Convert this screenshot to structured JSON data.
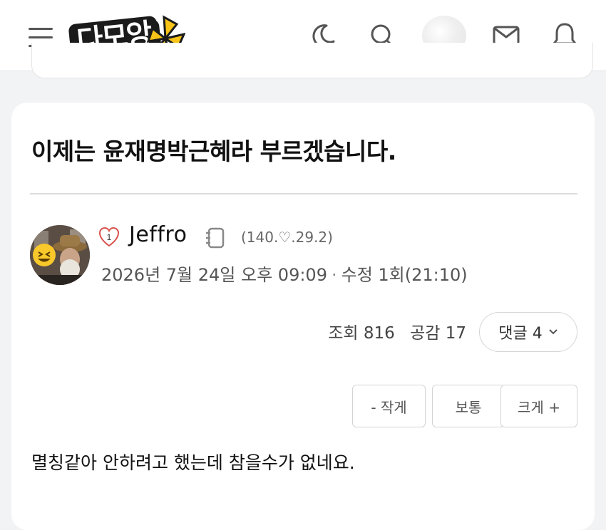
{
  "header": {
    "logo_text": "다모앙",
    "icons": [
      "menu-icon",
      "moon-icon",
      "search-icon",
      "profile-avatar",
      "mail-icon",
      "bell-icon"
    ]
  },
  "post": {
    "title": "이제는 윤재명박근혜라 부르겠습니다.",
    "author": {
      "level": "1",
      "nickname": "Jeffro",
      "ip": "(140.♡.29.2)"
    },
    "date": "2026년 7월 24일 오후 09:09",
    "edit_info": "수정 1회(21:10)",
    "stats": {
      "views_label": "조회 816",
      "likes_label": "공감 17"
    },
    "comment_button": "댓글 4",
    "font_size_buttons": {
      "small": "- 작게",
      "normal": "보통",
      "large": "크게 +"
    },
    "body": "멸칭같아 안하려고 했는데 참을수가 없네요."
  },
  "colors": {
    "background": "#f2f3f5",
    "card": "#ffffff",
    "logo_yellow": "#f7c417",
    "text_primary": "#111111",
    "text_secondary": "#555555"
  }
}
